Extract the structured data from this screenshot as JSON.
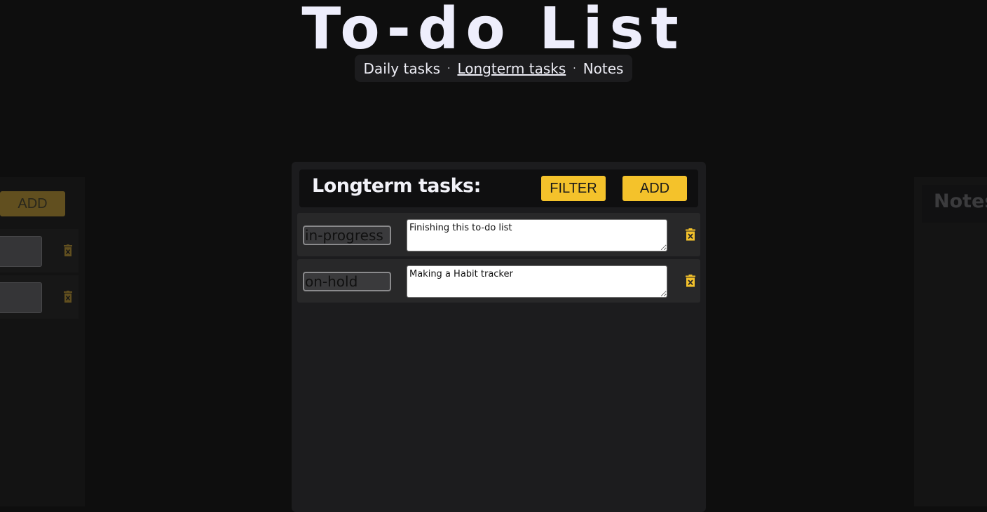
{
  "header": {
    "title": "To-do List"
  },
  "nav": {
    "items": [
      {
        "label": "Daily tasks",
        "active": false
      },
      {
        "label": "Longterm tasks",
        "active": true
      },
      {
        "label": "Notes",
        "active": false
      }
    ],
    "separator": "·"
  },
  "main_panel": {
    "title": "Longterm tasks:",
    "filter_label": "FILTER",
    "add_label": "ADD",
    "tasks": [
      {
        "status": "in-progress",
        "text": "Finishing this to-do list"
      },
      {
        "status": "on-hold",
        "text": "Making a Habit tracker"
      }
    ]
  },
  "left_panel": {
    "add_label": "ADD"
  },
  "right_panel": {
    "title": "Notes"
  },
  "colors": {
    "background": "#0e0e0e",
    "panel": "#1c1c1e",
    "accent": "#f4c22b"
  },
  "icons": {
    "delete": "trash-icon"
  }
}
